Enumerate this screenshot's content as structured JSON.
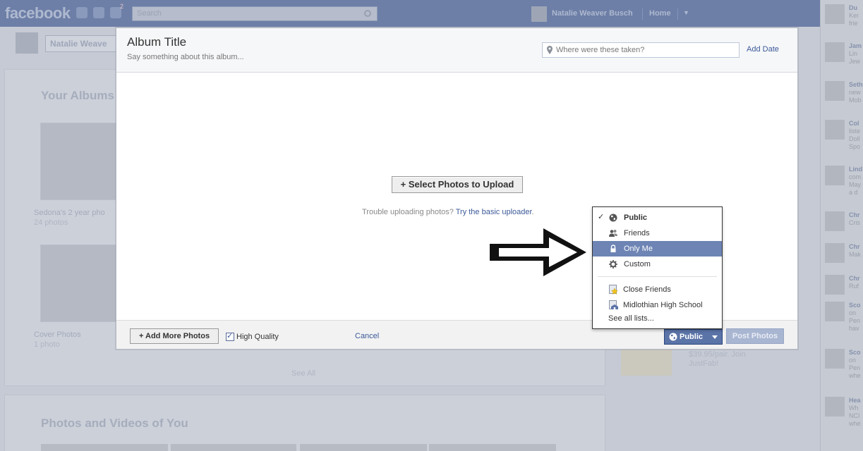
{
  "topbar": {
    "logo": "facebook",
    "notification_count": "2",
    "search_placeholder": "Search",
    "user_name": "Natalie Weaver Busch",
    "home_label": "Home"
  },
  "background": {
    "profile_name": "Natalie Weave",
    "your_albums_heading": "Your Albums",
    "albums": [
      {
        "title": "Sedona's 2 year pho",
        "count": "24 photos"
      },
      {
        "title": "Cover Photos",
        "count": "1 photo"
      }
    ],
    "see_all": "See All",
    "photos_of_you_heading": "Photos and Videos of You",
    "ad_text": "$39.95/pair. Join JustFab!",
    "ticker": [
      {
        "name": "Du",
        "lines": [
          "Ker",
          "frie"
        ]
      },
      {
        "name": "Jam",
        "lines": [
          "Lin",
          "Jew"
        ]
      },
      {
        "name": "Seth",
        "lines": [
          "new",
          "Mob"
        ]
      },
      {
        "name": "Col",
        "lines": [
          "liste",
          "Doll",
          "Spo"
        ]
      },
      {
        "name": "Lind",
        "lines": [
          "com",
          "May",
          "a d"
        ]
      },
      {
        "name": "Chr",
        "lines": [
          "Cris"
        ]
      },
      {
        "name": "Chr",
        "lines": [
          "Mak"
        ]
      },
      {
        "name": "Chr",
        "lines": [
          "Ruf"
        ]
      },
      {
        "name": "Sco",
        "lines": [
          "on",
          "Pen",
          "hav"
        ]
      },
      {
        "name": "Sco",
        "lines": [
          "on",
          "Pen",
          "whe"
        ]
      },
      {
        "name": "Hea",
        "lines": [
          "Wh",
          "NCI",
          "whe"
        ]
      }
    ]
  },
  "dialog": {
    "album_title": "Album Title",
    "album_description": "Say something about this album...",
    "location_placeholder": "Where were these taken?",
    "add_date": "Add Date",
    "select_photos_label": "+ Select Photos to Upload",
    "trouble_text": "Trouble uploading photos?",
    "trouble_link": "Try the basic uploader",
    "trouble_suffix": ".",
    "footer": {
      "add_more_label": "+ Add More Photos",
      "high_quality_label": "High Quality",
      "high_quality_checked": true,
      "cancel_label": "Cancel",
      "privacy_label": "Public",
      "post_label": "Post Photos"
    }
  },
  "privacy_menu": {
    "options": [
      {
        "label": "Public",
        "icon": "globe-icon",
        "checked": true,
        "highlighted": false
      },
      {
        "label": "Friends",
        "icon": "friends-icon",
        "checked": false,
        "highlighted": false
      },
      {
        "label": "Only Me",
        "icon": "lock-icon",
        "checked": false,
        "highlighted": true
      },
      {
        "label": "Custom",
        "icon": "gear-icon",
        "checked": false,
        "highlighted": false
      }
    ],
    "lists": [
      {
        "label": "Close Friends",
        "icon": "star-list-icon"
      },
      {
        "label": "Midlothian High School",
        "icon": "school-list-icon"
      }
    ],
    "see_all_lists": "See all lists...",
    "check_glyph": "✓"
  },
  "colors": {
    "fb_blue": "#3b5998",
    "menu_highlight": "#6d84b4",
    "arrow": "#111111"
  }
}
